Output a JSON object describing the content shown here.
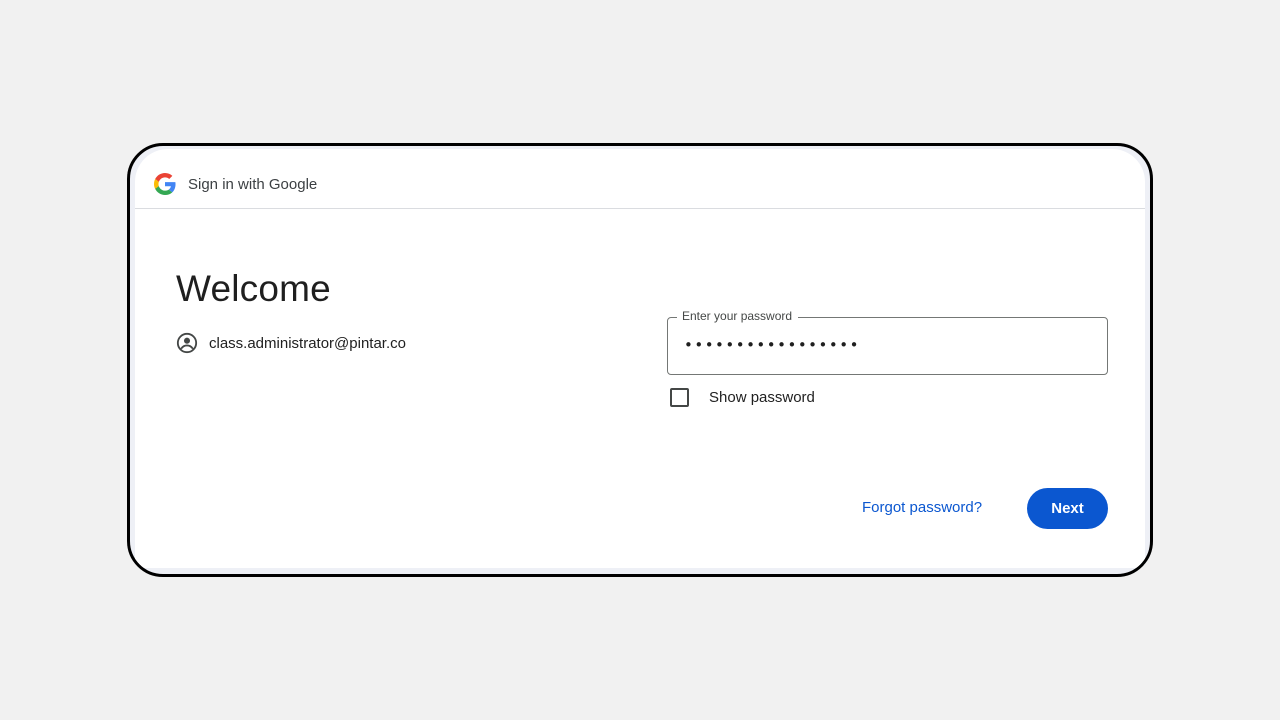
{
  "header": {
    "title": "Sign in with Google",
    "logo_icon": "google-g-icon"
  },
  "main": {
    "heading": "Welcome",
    "account_icon": "account-circle-icon",
    "account_email": "class.administrator@pintar.co"
  },
  "password_field": {
    "label": "Enter your password",
    "value": "•••••••••••••••••"
  },
  "show_password": {
    "label": "Show password",
    "checked": false
  },
  "actions": {
    "forgot_label": "Forgot password?",
    "next_label": "Next"
  },
  "colors": {
    "primary": "#0b57d0",
    "google_blue": "#4285F4",
    "google_red": "#EA4335",
    "google_yellow": "#FBBC05",
    "google_green": "#34A853"
  }
}
